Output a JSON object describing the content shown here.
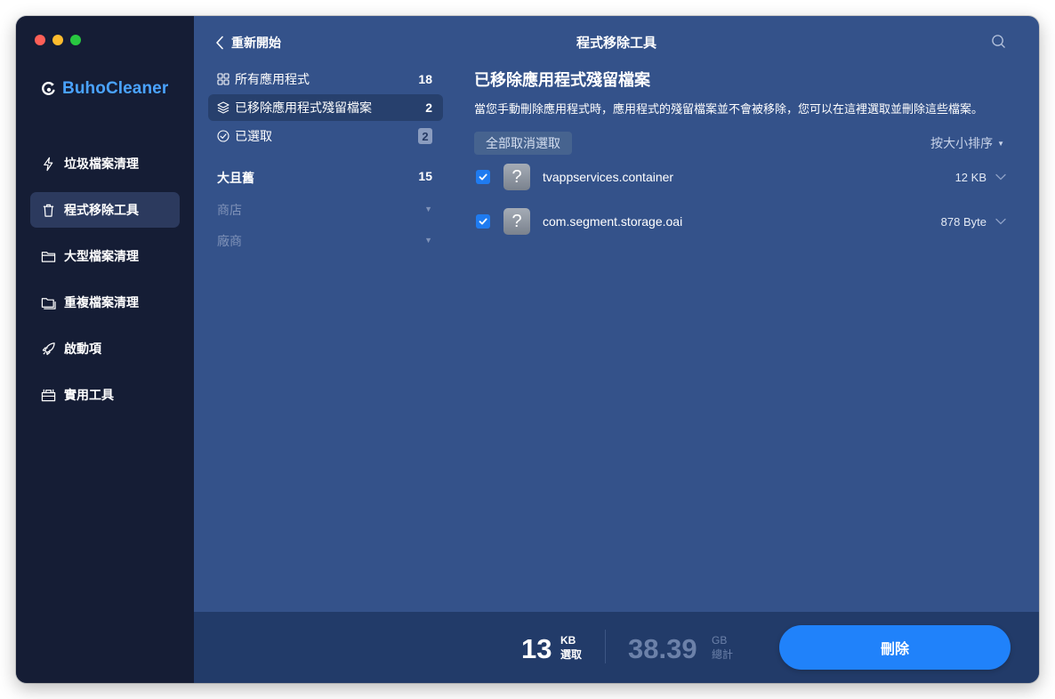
{
  "app": {
    "name": "BuhoCleaner",
    "window_title": "程式移除工具"
  },
  "header": {
    "back_label": "重新開始"
  },
  "sidebar": {
    "items": [
      {
        "label": "垃圾檔案清理",
        "icon": "lightning-icon",
        "active": false
      },
      {
        "label": "程式移除工具",
        "icon": "trash-icon",
        "active": true
      },
      {
        "label": "大型檔案清理",
        "icon": "folder-icon",
        "active": false
      },
      {
        "label": "重複檔案清理",
        "icon": "duplicate-folder-icon",
        "active": false
      },
      {
        "label": "啟動項",
        "icon": "rocket-icon",
        "active": false
      },
      {
        "label": "實用工具",
        "icon": "toolbox-icon",
        "active": false
      }
    ]
  },
  "categories": {
    "items": [
      {
        "label": "所有應用程式",
        "count": "18",
        "icon": "grid-icon"
      },
      {
        "label": "已移除應用程式殘留檔案",
        "count": "2",
        "icon": "layers-icon"
      },
      {
        "label": "已選取",
        "count": "2",
        "icon": "check-circle-icon"
      }
    ],
    "group": {
      "label": "大且舊",
      "count": "15"
    },
    "filters": [
      {
        "label": "商店"
      },
      {
        "label": "廠商"
      }
    ]
  },
  "content": {
    "title": "已移除應用程式殘留檔案",
    "description": "當您手動刪除應用程式時，應用程式的殘留檔案並不會被移除，您可以在這裡選取並刪除這些檔案。",
    "deselect_all_label": "全部取消選取",
    "sort_label": "按大小排序",
    "files": [
      {
        "name": "tvappservices.container",
        "size": "12 KB",
        "checked": true
      },
      {
        "name": "com.segment.storage.oai",
        "size": "878 Byte",
        "checked": true
      }
    ]
  },
  "footer": {
    "selected_value": "13",
    "selected_unit": "KB",
    "selected_label": "選取",
    "total_value": "38.39",
    "total_unit": "GB",
    "total_label": "總計",
    "delete_label": "刪除"
  },
  "colors": {
    "sidebar_bg": "#151d35",
    "main_bg": "#34528a",
    "bottom_bg": "#223b69",
    "accent": "#2082fa",
    "logo": "#4aa3ff"
  }
}
